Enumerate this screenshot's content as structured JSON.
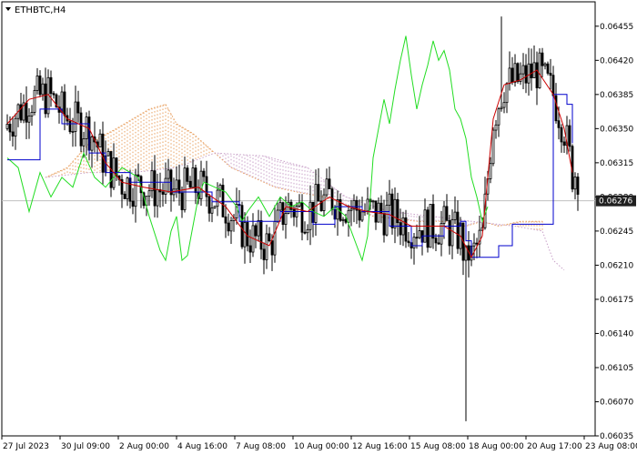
{
  "window": {
    "symbol_label": "ETHBTC,H4",
    "menu_icon": "triangle-down-icon"
  },
  "chart_data": {
    "type": "candlestick",
    "title": "",
    "instrument": "ETHBTC",
    "timeframe": "H4",
    "ylim": [
      0.06035,
      0.0648
    ],
    "y_ticks": [
      "0.06455",
      "0.06420",
      "0.06385",
      "0.06350",
      "0.06315",
      "0.06280",
      "0.06245",
      "0.06210",
      "0.06175",
      "0.06140",
      "0.06105",
      "0.06070",
      "0.06035"
    ],
    "x_ticks": [
      "27 Jul 2023",
      "30 Jul 09:00",
      "2 Aug 00:00",
      "4 Aug 16:00",
      "7 Aug 08:00",
      "10 Aug 00:00",
      "12 Aug 16:00",
      "15 Aug 08:00",
      "18 Aug 00:00",
      "20 Aug 17:00",
      "23 Aug 08:00"
    ],
    "current_price": "0.06276",
    "colors": {
      "candles": "#000000",
      "tenkan_sen": "#cc0000",
      "kijun_sen": "#0000cc",
      "chikou_span": "#22dd22",
      "senkou_a_cloud": "#e8a060",
      "senkou_b_cloud": "#c8a0c8",
      "price_line": "#c0c0c0",
      "price_box": "#202020"
    },
    "indicators": {
      "kijun_sen": [
        [
          0,
          0.06318
        ],
        [
          12,
          0.0637
        ],
        [
          18,
          0.0637
        ],
        [
          20,
          0.06355
        ],
        [
          28,
          0.06355
        ],
        [
          30,
          0.06325
        ],
        [
          36,
          0.06305
        ],
        [
          45,
          0.06295
        ],
        [
          60,
          0.06285
        ],
        [
          75,
          0.06275
        ],
        [
          85,
          0.06255
        ],
        [
          100,
          0.06265
        ],
        [
          112,
          0.06252
        ],
        [
          120,
          0.0627
        ],
        [
          130,
          0.06265
        ],
        [
          140,
          0.0625
        ],
        [
          148,
          0.0623
        ],
        [
          152,
          0.0624
        ],
        [
          160,
          0.0625
        ],
        [
          166,
          0.06255
        ],
        [
          168,
          0.06235
        ],
        [
          170,
          0.06218
        ],
        [
          180,
          0.0623
        ],
        [
          185,
          0.06252
        ],
        [
          198,
          0.06252
        ],
        [
          200,
          0.06385
        ],
        [
          205,
          0.06375
        ],
        [
          207,
          0.06335
        ]
      ],
      "tenkan_sen": [
        [
          0,
          0.06355
        ],
        [
          8,
          0.0638
        ],
        [
          15,
          0.06385
        ],
        [
          22,
          0.0636
        ],
        [
          30,
          0.0635
        ],
        [
          36,
          0.06315
        ],
        [
          42,
          0.06295
        ],
        [
          50,
          0.0629
        ],
        [
          60,
          0.06285
        ],
        [
          70,
          0.0629
        ],
        [
          80,
          0.0627
        ],
        [
          88,
          0.0624
        ],
        [
          96,
          0.0623
        ],
        [
          102,
          0.0627
        ],
        [
          110,
          0.06265
        ],
        [
          118,
          0.0628
        ],
        [
          125,
          0.0627
        ],
        [
          132,
          0.06265
        ],
        [
          140,
          0.06262
        ],
        [
          148,
          0.0625
        ],
        [
          154,
          0.0625
        ],
        [
          160,
          0.0625
        ],
        [
          166,
          0.0624
        ],
        [
          170,
          0.06218
        ],
        [
          174,
          0.0624
        ],
        [
          178,
          0.0636
        ],
        [
          182,
          0.06395
        ],
        [
          188,
          0.064
        ],
        [
          194,
          0.0641
        ],
        [
          200,
          0.06385
        ],
        [
          204,
          0.0635
        ],
        [
          207,
          0.06305
        ]
      ],
      "chikou_span": [
        [
          0,
          0.0632
        ],
        [
          4,
          0.0631
        ],
        [
          8,
          0.06265
        ],
        [
          12,
          0.06305
        ],
        [
          16,
          0.0628
        ],
        [
          20,
          0.063
        ],
        [
          24,
          0.0629
        ],
        [
          28,
          0.06325
        ],
        [
          32,
          0.063
        ],
        [
          36,
          0.0629
        ],
        [
          42,
          0.0631
        ],
        [
          48,
          0.063
        ],
        [
          52,
          0.0626
        ],
        [
          56,
          0.06225
        ],
        [
          58,
          0.06215
        ],
        [
          60,
          0.06245
        ],
        [
          62,
          0.0626
        ],
        [
          64,
          0.06215
        ],
        [
          66,
          0.0622
        ],
        [
          68,
          0.0625
        ],
        [
          70,
          0.0628
        ],
        [
          72,
          0.06295
        ],
        [
          76,
          0.0629
        ],
        [
          80,
          0.06285
        ],
        [
          84,
          0.0627
        ],
        [
          86,
          0.06255
        ],
        [
          88,
          0.06265
        ],
        [
          92,
          0.0628
        ],
        [
          96,
          0.0626
        ],
        [
          100,
          0.0628
        ],
        [
          104,
          0.0627
        ],
        [
          108,
          0.06275
        ],
        [
          112,
          0.06265
        ],
        [
          116,
          0.0626
        ],
        [
          120,
          0.0627
        ],
        [
          124,
          0.0626
        ],
        [
          128,
          0.0623
        ],
        [
          130,
          0.06215
        ],
        [
          132,
          0.0624
        ],
        [
          134,
          0.0632
        ],
        [
          136,
          0.0635
        ],
        [
          138,
          0.0638
        ],
        [
          140,
          0.06355
        ],
        [
          142,
          0.0639
        ],
        [
          144,
          0.0642
        ],
        [
          146,
          0.06445
        ],
        [
          148,
          0.06405
        ],
        [
          150,
          0.0637
        ],
        [
          152,
          0.06395
        ],
        [
          154,
          0.06415
        ],
        [
          156,
          0.0644
        ],
        [
          158,
          0.0642
        ],
        [
          160,
          0.0643
        ],
        [
          162,
          0.0641
        ],
        [
          164,
          0.0637
        ],
        [
          166,
          0.0636
        ],
        [
          168,
          0.0634
        ],
        [
          170,
          0.063
        ],
        [
          172,
          0.0628
        ],
        [
          174,
          0.06255
        ],
        [
          176,
          0.0627
        ]
      ],
      "senkou_a": [
        [
          14,
          0.063
        ],
        [
          22,
          0.0631
        ],
        [
          30,
          0.06335
        ],
        [
          40,
          0.0635
        ],
        [
          46,
          0.0636
        ],
        [
          52,
          0.0637
        ],
        [
          58,
          0.06375
        ],
        [
          62,
          0.06355
        ],
        [
          68,
          0.06345
        ],
        [
          74,
          0.0633
        ],
        [
          82,
          0.0631
        ],
        [
          90,
          0.063
        ],
        [
          98,
          0.0629
        ],
        [
          106,
          0.06285
        ],
        [
          116,
          0.0628
        ],
        [
          126,
          0.0627
        ],
        [
          134,
          0.0626
        ],
        [
          142,
          0.06258
        ],
        [
          150,
          0.06255
        ],
        [
          160,
          0.06255
        ],
        [
          168,
          0.0625
        ],
        [
          174,
          0.06255
        ],
        [
          180,
          0.0625
        ],
        [
          188,
          0.06255
        ],
        [
          196,
          0.06255
        ]
      ],
      "senkou_b": [
        [
          14,
          0.063
        ],
        [
          30,
          0.06305
        ],
        [
          46,
          0.06305
        ],
        [
          62,
          0.0631
        ],
        [
          76,
          0.06325
        ],
        [
          94,
          0.06322
        ],
        [
          110,
          0.0631
        ],
        [
          124,
          0.0628
        ],
        [
          140,
          0.06265
        ],
        [
          156,
          0.0626
        ],
        [
          170,
          0.06255
        ],
        [
          186,
          0.0625
        ],
        [
          196,
          0.06245
        ],
        [
          200,
          0.06215
        ],
        [
          204,
          0.06205
        ]
      ]
    }
  }
}
